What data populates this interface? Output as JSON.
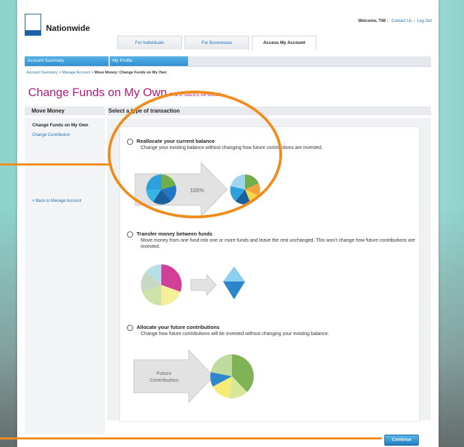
{
  "header": {
    "brand": "Nationwide",
    "welcome": "Welcome, TIM :",
    "contact_link": "Contact Us",
    "logout_link": "Log Out"
  },
  "tabs": [
    {
      "label": "For Individuals"
    },
    {
      "label": "For Businesses"
    },
    {
      "label": "Access My Account",
      "active": true
    }
  ],
  "navbar": {
    "account_summary": "Account Summary",
    "my_profile": "My Profile"
  },
  "breadcrumb": {
    "item1": "Account Summary",
    "sep1": ">",
    "item2": "Manage Account",
    "sep2": ">",
    "current": "Move Money: Change Funds on My Own"
  },
  "page": {
    "title": "Change Funds on My Own",
    "subtitle": "R & D SALES 04-80002"
  },
  "left": {
    "heading": "Move Money",
    "active_item": "Change Funds on My Own",
    "link_change_contribution": "Change Contribution",
    "back_link": "< Back to Manage Account"
  },
  "main": {
    "heading": "Select a type of transaction",
    "options": [
      {
        "title": "Reallocate your current balance",
        "desc": "Change your existing balance without changing how future contributions are invested.",
        "arrow_label": "100%"
      },
      {
        "title": "Transfer money between funds",
        "desc": "Move money from one fund into one or more funds and leave the rest unchanged. This won't change how future contributions are invested."
      },
      {
        "title": "Allocate your future contributions",
        "desc": "Change how future contributions will be invested without changing your existing balance.",
        "arrow_label_line1": "Future",
        "arrow_label_line2": "Contribution"
      }
    ],
    "continue_label": "Continue"
  },
  "colors": {
    "accent": "#b01a7a",
    "link": "#1f6fb5",
    "highlight": "#f08c1e",
    "nav": "#2f8fd0"
  }
}
